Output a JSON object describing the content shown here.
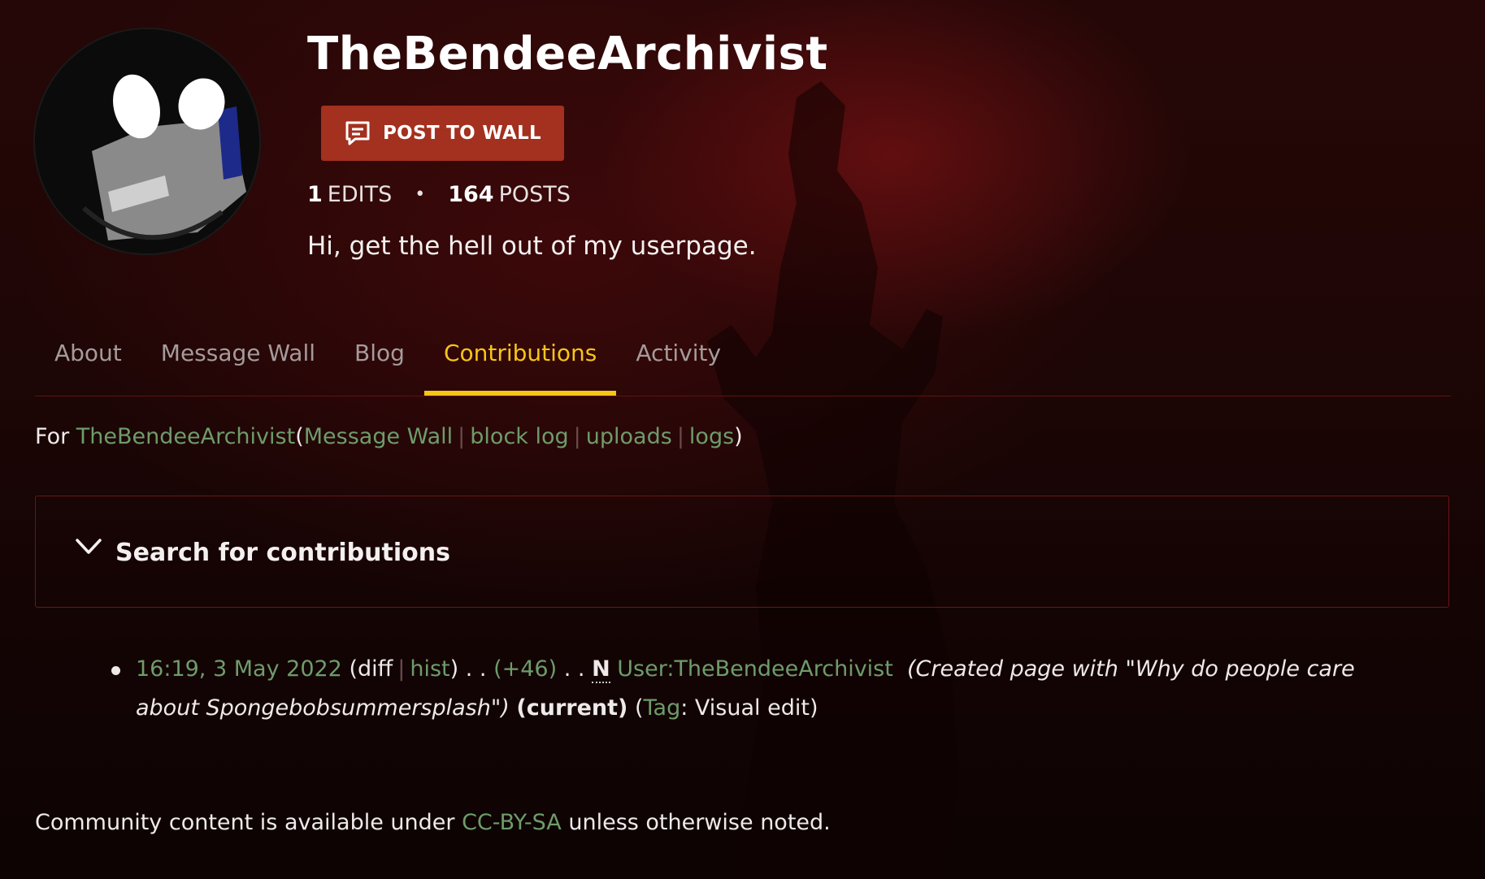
{
  "profile": {
    "username": "TheBendeeArchivist",
    "post_button_label": "POST TO WALL",
    "edits_count": "1",
    "edits_label": "EDITS",
    "posts_count": "164",
    "posts_label": "POSTS",
    "bio": "Hi, get the hell out of my userpage."
  },
  "tabs": [
    {
      "label": "About",
      "active": false
    },
    {
      "label": "Message Wall",
      "active": false
    },
    {
      "label": "Blog",
      "active": false
    },
    {
      "label": "Contributions",
      "active": true
    },
    {
      "label": "Activity",
      "active": false
    }
  ],
  "for_line": {
    "prefix": "For",
    "user_link": "TheBendeeArchivist",
    "open_paren": "(",
    "links": [
      "Message Wall",
      "block log",
      "uploads",
      "logs"
    ],
    "close_paren": ")"
  },
  "search": {
    "title": "Search for contributions",
    "icon": "chevron-down-icon"
  },
  "contributions": [
    {
      "timestamp": "16:19, 3 May 2022",
      "diff_label": "diff",
      "hist_label": "hist",
      "dots1": ". .",
      "size_change": "(+46)",
      "dots2": ". .",
      "new_flag": "N",
      "page": "User:TheBendeeArchivist",
      "summary": "(Created page with \"Why do people care about Spongebobsummersplash\")",
      "current_label": "(current)",
      "tag_label": "Tag",
      "tag_value": ": Visual edit)"
    }
  ],
  "footer": {
    "prefix": "Community content is available under",
    "license_link": "CC-BY-SA",
    "suffix": "unless otherwise noted."
  },
  "colors": {
    "accent_yellow": "#f5c518",
    "button_red": "#a4301f",
    "link_green": "#6e9c6a"
  }
}
